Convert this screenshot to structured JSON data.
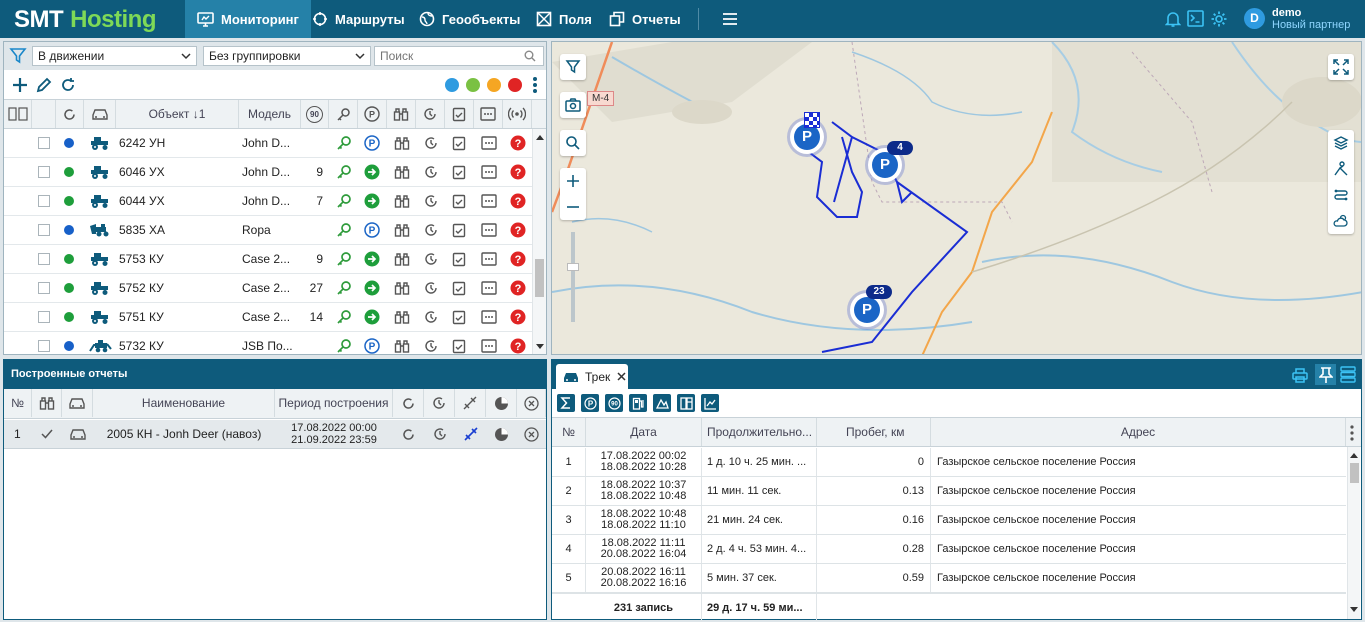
{
  "app": {
    "logo_part1": "SMT",
    "logo_part2": "Hosting"
  },
  "nav": [
    {
      "label": "Мониторинг",
      "icon": "monitor-icon"
    },
    {
      "label": "Маршруты",
      "icon": "route-icon"
    },
    {
      "label": "Геообъекты",
      "icon": "globe-icon"
    },
    {
      "label": "Поля",
      "icon": "field-icon"
    },
    {
      "label": "Отчеты",
      "icon": "reports-icon"
    }
  ],
  "user": {
    "avatar": "D",
    "name": "demo",
    "role": "Новый партнер"
  },
  "filters": {
    "status": "В движении",
    "grouping": "Без группировки",
    "search_placeholder": "Поиск"
  },
  "objects_table": {
    "headers": {
      "object": "Объект ↓1",
      "model": "Модель",
      "speed": "90"
    },
    "rows": [
      {
        "color": "#1760c8",
        "icon": "tractor-icon",
        "name": "6242 УН",
        "model": "John D...",
        "speed": "",
        "parking": true
      },
      {
        "color": "#1e9e3b",
        "icon": "tractor-icon",
        "name": "6046 УХ",
        "model": "John D...",
        "speed": "9",
        "parking": false
      },
      {
        "color": "#1e9e3b",
        "icon": "tractor-icon",
        "name": "6044 УХ",
        "model": "John D...",
        "speed": "7",
        "parking": false
      },
      {
        "color": "#1760c8",
        "icon": "harvester-icon",
        "name": "5835 ХА",
        "model": "Ropa",
        "speed": "",
        "parking": true
      },
      {
        "color": "#1e9e3b",
        "icon": "tractor-icon",
        "name": "5753 КУ",
        "model": "Case 2...",
        "speed": "9",
        "parking": false
      },
      {
        "color": "#1e9e3b",
        "icon": "tractor-icon",
        "name": "5752 КУ",
        "model": "Case 2...",
        "speed": "27",
        "parking": false
      },
      {
        "color": "#1e9e3b",
        "icon": "tractor-icon",
        "name": "5751 КУ",
        "model": "Case 2...",
        "speed": "14",
        "parking": false
      },
      {
        "color": "#1760c8",
        "icon": "loader-icon",
        "name": "5732 КУ",
        "model": "JSB По...",
        "speed": "",
        "parking": true
      }
    ]
  },
  "reports": {
    "title": "Построенные отчеты",
    "headers": {
      "num": "№",
      "name": "Наименование",
      "period": "Период построения"
    },
    "rows": [
      {
        "num": "1",
        "name": "2005 КН - Jonh Deer (навоз)",
        "period_from": "17.08.2022 00:00",
        "period_to": "21.09.2022 23:59"
      }
    ]
  },
  "map": {
    "road_label": "М-4",
    "markers": [
      {
        "label": "4"
      },
      {
        "label": "23"
      }
    ]
  },
  "track": {
    "tab_label": "Трек",
    "headers": {
      "num": "№",
      "date": "Дата",
      "duration": "Продолжительно...",
      "mileage": "Пробег, км",
      "address": "Адрес"
    },
    "rows": [
      {
        "num": "1",
        "date1": "17.08.2022 00:02",
        "date2": "18.08.2022 10:28",
        "duration": "1 д. 10 ч. 25 мин. ...",
        "mileage": "0",
        "address": "Газырское сельское поселение Россия"
      },
      {
        "num": "2",
        "date1": "18.08.2022 10:37",
        "date2": "18.08.2022 10:48",
        "duration": "11 мин. 11 сек.",
        "mileage": "0.13",
        "address": "Газырское сельское поселение Россия"
      },
      {
        "num": "3",
        "date1": "18.08.2022 10:48",
        "date2": "18.08.2022 11:10",
        "duration": "21 мин. 24 сек.",
        "mileage": "0.16",
        "address": "Газырское сельское поселение Россия"
      },
      {
        "num": "4",
        "date1": "18.08.2022 11:11",
        "date2": "20.08.2022 16:04",
        "duration": "2 д. 4 ч. 53 мин. 4...",
        "mileage": "0.28",
        "address": "Газырское сельское поселение Россия"
      },
      {
        "num": "5",
        "date1": "20.08.2022 16:11",
        "date2": "20.08.2022 16:16",
        "duration": "5 мин. 37 сек.",
        "mileage": "0.59",
        "address": "Газырское сельское поселение Россия"
      }
    ],
    "footer": {
      "count": "231 запись",
      "total_duration": "29 д. 17 ч. 59 ми..."
    }
  }
}
